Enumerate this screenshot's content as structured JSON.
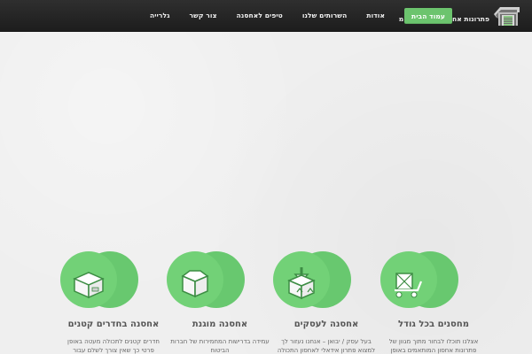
{
  "nav": {
    "items": [
      {
        "label": "עמוד הבית"
      },
      {
        "label": "אודות"
      },
      {
        "label": "השרותים שלנו"
      },
      {
        "label": "טיפים לאחסנה"
      },
      {
        "label": "צור קשר"
      },
      {
        "label": "גלרייה"
      }
    ],
    "active_index": 0
  },
  "logo": {
    "text": "פתרונות אחסנה במרכז בע\"מ"
  },
  "features": [
    {
      "title": "אחסנה בחדרים קטנים",
      "text": "חדרים קטנים לתכולה מעטה באופן\nפרטי כך שאין צורך לשלם עבור",
      "icon": "small-box-icon"
    },
    {
      "title": "אחסנה מוגנת",
      "text": "עמידה בדרישות המחמירות של חברות\nהביטוח",
      "icon": "open-box-icon"
    },
    {
      "title": "אחסנה לעסקים",
      "text": "בעל עסק / יבואן – אנחנו נעזור לך\nלמצוא פתרון אידאלי לאחסון התכולה",
      "icon": "storage-box-arrow-icon"
    },
    {
      "title": "מחסנים בכל גודל",
      "text": "אצלנו תוכלו לבחור מתוך מגוון של\nפתרונות אחסון המותאמים באופן",
      "icon": "cart-crate-icon"
    }
  ],
  "colors": {
    "nav_active": "#6cc46e",
    "circle_main": "#72d177",
    "circle_shadow": "#68c86f",
    "topbar": "#222222"
  }
}
